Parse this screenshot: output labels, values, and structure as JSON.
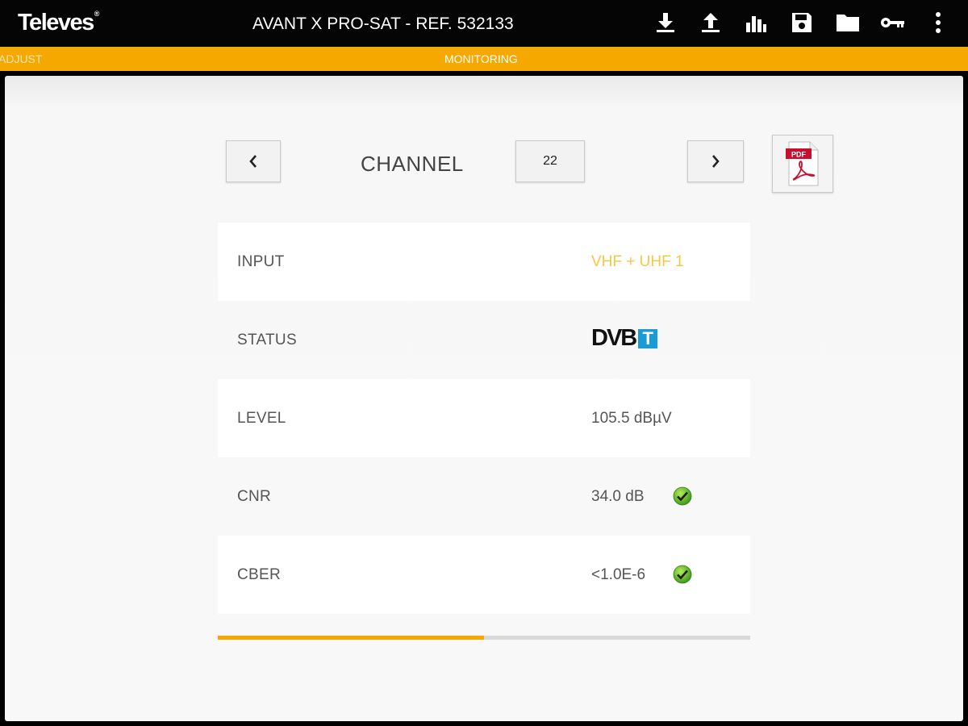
{
  "header": {
    "logo": "Televes",
    "title": "AVANT X  PRO-SAT - REF. 532133",
    "icons": [
      "download-icon",
      "upload-icon",
      "bar-chart-icon",
      "save-icon",
      "folder-icon",
      "key-icon",
      "more-vert-icon"
    ]
  },
  "tabs": {
    "adjust": "ADJUST",
    "monitoring": "MONITORING",
    "active": "monitoring"
  },
  "channel": {
    "label": "CHANNEL",
    "value": "22"
  },
  "pdf": {
    "label": "PDF"
  },
  "rows": [
    {
      "label": "INPUT",
      "value": "VHF + UHF 1"
    },
    {
      "label": "STATUS",
      "value": "DVB",
      "badge": "T"
    },
    {
      "label": "LEVEL",
      "value": "105.5 dBµV"
    },
    {
      "label": "CNR",
      "value": "34.0 dB",
      "ok": true
    },
    {
      "label": "CBER",
      "value": "<1.0E-6",
      "ok": true
    }
  ],
  "progress": {
    "fraction": 0.5
  },
  "colors": {
    "accent": "#f4a800",
    "input_value": "#f6c744",
    "dvb_badge": "#1a9ad6",
    "check": "#5cb82e"
  }
}
